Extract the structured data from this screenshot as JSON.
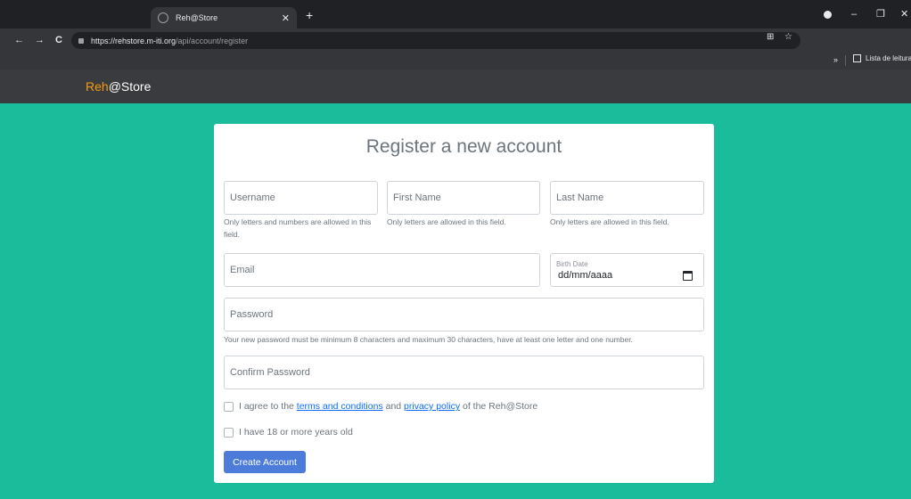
{
  "browser": {
    "tab_title": "Reh@Store",
    "tab_close": "✕",
    "new_tab": "+",
    "url_host": "https://rehstore.m-iti.org",
    "url_path": "/api/account/register",
    "back": "←",
    "forward": "→",
    "reload": "C",
    "minimize": "–",
    "restore": "❐",
    "close": "✕",
    "omni_icons": [
      "⊞",
      "☆"
    ],
    "bookmarks_more": "»",
    "reading_list_label": "Lista de leitura"
  },
  "site": {
    "brand_accent": "Reh",
    "brand_rest": "@Store"
  },
  "form": {
    "title": "Register a new account",
    "username_placeholder": "Username",
    "username_help": "Only letters and numbers are allowed in this field.",
    "first_name_placeholder": "First Name",
    "first_name_help": "Only letters are allowed in this field.",
    "last_name_placeholder": "Last Name",
    "last_name_help": "Only letters are allowed in this field.",
    "email_placeholder": "Email",
    "birth_date_label": "Birth Date",
    "birth_date_value": "dd/mm/aaaa",
    "password_placeholder": "Password",
    "password_help": "Your new password must be minimum 8 characters and maximum 30 characters, have at least one letter and one number.",
    "confirm_password_placeholder": "Confirm Password",
    "terms_prefix": "I agree to the ",
    "terms_link": "terms and conditions",
    "terms_and": " and ",
    "privacy_link": "privacy policy",
    "terms_suffix": " of the Reh@Store",
    "age_label": "I have 18 or more years old",
    "submit_label": "Create Account"
  },
  "colors": {
    "page_bg": "#1abc9c",
    "navbar_bg": "#3a3b3f",
    "brand_accent": "#f39c12",
    "primary_button": "#4c7bd9",
    "link": "#0d6efd"
  }
}
